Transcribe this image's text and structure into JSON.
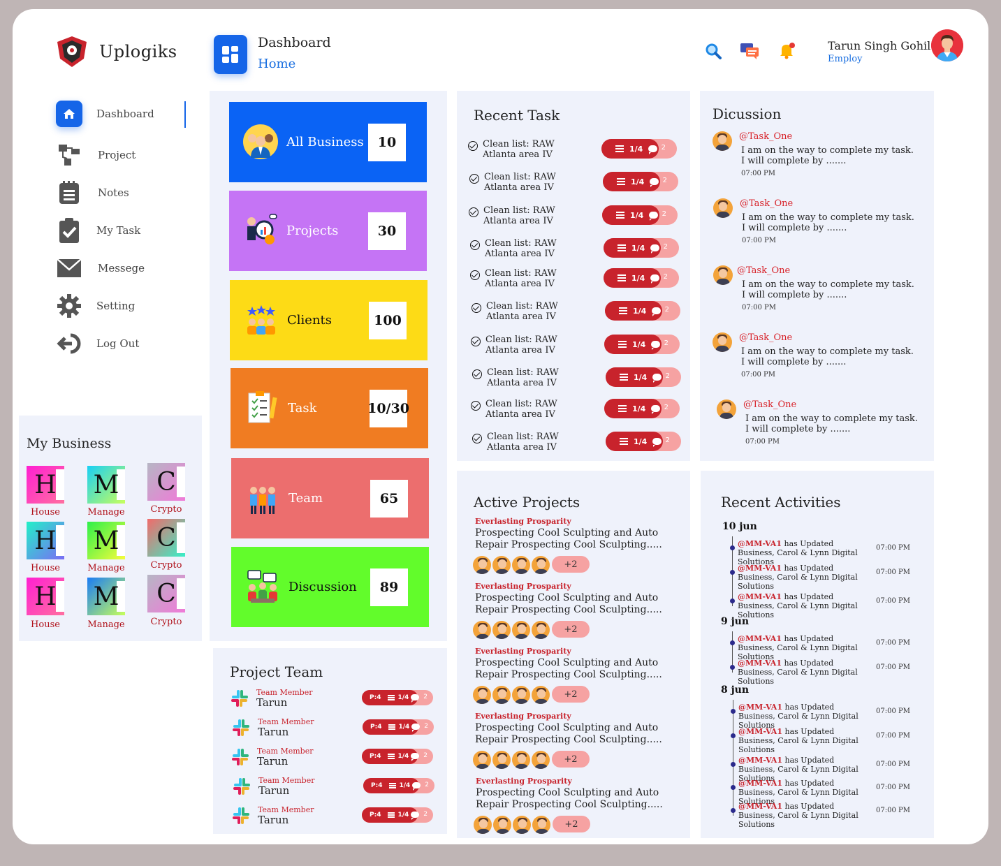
{
  "brand": {
    "name": "Uplogiks"
  },
  "header": {
    "title": "Dashboard",
    "breadcrumb": "Home"
  },
  "user": {
    "name": "Tarun Singh Gohil",
    "role": "Employ"
  },
  "nav": [
    {
      "label": "Dashboard",
      "icon": "home-icon"
    },
    {
      "label": "Project",
      "icon": "project-icon"
    },
    {
      "label": "Notes",
      "icon": "notes-icon"
    },
    {
      "label": "My Task",
      "icon": "clipboard-check-icon"
    },
    {
      "label": "Messege",
      "icon": "mail-icon"
    },
    {
      "label": "Setting",
      "icon": "gear-icon"
    },
    {
      "label": "Log Out",
      "icon": "logout-icon"
    }
  ],
  "business": {
    "title": "My Business",
    "items": [
      {
        "letter": "H",
        "label": "House"
      },
      {
        "letter": "M",
        "label": "Manage"
      },
      {
        "letter": "C",
        "label": "Crypto"
      },
      {
        "letter": "H",
        "label": "House"
      },
      {
        "letter": "M",
        "label": "Manage"
      },
      {
        "letter": "C",
        "label": "Crypto"
      },
      {
        "letter": "H",
        "label": "House"
      },
      {
        "letter": "M",
        "label": "Manage"
      },
      {
        "letter": "C",
        "label": "Crypto"
      }
    ]
  },
  "stats": [
    {
      "label": "All Business",
      "value": "10",
      "color": "#0a63f5"
    },
    {
      "label": "Projects",
      "value": "30",
      "color": "#c574f5"
    },
    {
      "label": "Clients",
      "value": "100",
      "color": "#fddb16"
    },
    {
      "label": "Task",
      "value": "10/30",
      "color": "#f07c22"
    },
    {
      "label": "Team",
      "value": "65",
      "color": "#ec6e6e"
    },
    {
      "label": "Discussion",
      "value": "89",
      "color": "#62fc2b"
    }
  ],
  "recent_task": {
    "title": "Recent Task",
    "items": [
      {
        "text": "Clean list: RAW Atlanta area IV",
        "progress": "1/4",
        "comments": "2"
      },
      {
        "text": "Clean list: RAW Atlanta area IV",
        "progress": "1/4",
        "comments": "2"
      },
      {
        "text": "Clean list: RAW Atlanta area IV",
        "progress": "1/4",
        "comments": "2"
      },
      {
        "text": "Clean list: RAW Atlanta area IV",
        "progress": "1/4",
        "comments": "2"
      },
      {
        "text": "Clean list: RAW Atlanta area IV",
        "progress": "1/4",
        "comments": "2"
      },
      {
        "text": "Clean list: RAW Atlanta area IV",
        "progress": "1/4",
        "comments": "2"
      },
      {
        "text": "Clean list: RAW Atlanta area IV",
        "progress": "1/4",
        "comments": "2"
      },
      {
        "text": "Clean list: RAW Atlanta area IV",
        "progress": "1/4",
        "comments": "2"
      },
      {
        "text": "Clean list: RAW Atlanta area IV",
        "progress": "1/4",
        "comments": "2"
      },
      {
        "text": "Clean list: RAW Atlanta area IV",
        "progress": "1/4",
        "comments": "2"
      }
    ]
  },
  "discussion": {
    "title": "Dicussion",
    "items": [
      {
        "user": "@Task_One",
        "message": "I am on the way to complete my task. I will complete by .......",
        "time": "07:00 PM"
      },
      {
        "user": "@Task_One",
        "message": "I am on the way to complete my task. I will complete by .......",
        "time": "07:00 PM"
      },
      {
        "user": "@Task_One",
        "message": "I am on the way to complete my task. I will complete by .......",
        "time": "07:00 PM"
      },
      {
        "user": "@Task_One",
        "message": "I am on the way to complete my task. I will complete by .......",
        "time": "07:00 PM"
      },
      {
        "user": "@Task_One",
        "message": "I am on the way to complete my task. I will complete by .......",
        "time": "07:00 PM"
      }
    ]
  },
  "active_projects": {
    "title": "Active Projects",
    "items": [
      {
        "tag": "Everlasting Prosparity",
        "desc": "Prospecting Cool Sculpting and Auto Repair Prospecting Cool Sculpting.....",
        "more": "+2"
      },
      {
        "tag": "Everlasting Prosparity",
        "desc": "Prospecting Cool Sculpting and Auto Repair Prospecting Cool Sculpting.....",
        "more": "+2"
      },
      {
        "tag": "Everlasting Prosparity",
        "desc": "Prospecting Cool Sculpting and Auto Repair Prospecting Cool Sculpting.....",
        "more": "+2"
      },
      {
        "tag": "Everlasting Prosparity",
        "desc": "Prospecting Cool Sculpting and Auto Repair Prospecting Cool Sculpting.....",
        "more": "+2"
      },
      {
        "tag": "Everlasting Prosparity",
        "desc": "Prospecting Cool Sculpting and Auto Repair Prospecting Cool Sculpting.....",
        "more": "+2"
      }
    ]
  },
  "project_team": {
    "title": "Project Team",
    "items": [
      {
        "role": "Team Member",
        "name": "Tarun",
        "p": "P:4",
        "progress": "1/4",
        "comments": "2"
      },
      {
        "role": "Team Member",
        "name": "Tarun",
        "p": "P:4",
        "progress": "1/4",
        "comments": "2"
      },
      {
        "role": "Team Member",
        "name": "Tarun",
        "p": "P:4",
        "progress": "1/4",
        "comments": "2"
      },
      {
        "role": "Team Member",
        "name": "Tarun",
        "p": "P:4",
        "progress": "1/4",
        "comments": "2"
      },
      {
        "role": "Team Member",
        "name": "Tarun",
        "p": "P:4",
        "progress": "1/4",
        "comments": "2"
      }
    ]
  },
  "recent_activities": {
    "title": "Recent Activities",
    "groups": [
      {
        "date": "10 jun",
        "items": [
          {
            "user": "@MM-VA1",
            "text": " has Updated Business, Carol & Lynn Digital Solutions",
            "time": "07:00 PM"
          },
          {
            "user": "@MM-VA1",
            "text": " has Updated Business, Carol & Lynn Digital Solutions",
            "time": "07:00 PM"
          },
          {
            "user": "@MM-VA1",
            "text": " has Updated Business, Carol & Lynn Digital Solutions",
            "time": "07:00 PM"
          }
        ]
      },
      {
        "date": "9 jun",
        "items": [
          {
            "user": "@MM-VA1",
            "text": " has Updated Business, Carol & Lynn Digital Solutions",
            "time": "07:00 PM"
          },
          {
            "user": "@MM-VA1",
            "text": " has Updated Business, Carol & Lynn Digital Solutions",
            "time": "07:00 PM"
          }
        ]
      },
      {
        "date": "8 jun",
        "items": [
          {
            "user": "@MM-VA1",
            "text": " has Updated Business, Carol & Lynn Digital Solutions",
            "time": "07:00 PM"
          },
          {
            "user": "@MM-VA1",
            "text": " has Updated Business, Carol & Lynn Digital Solutions",
            "time": "07:00 PM"
          },
          {
            "user": "@MM-VA1",
            "text": " has Updated Business, Carol & Lynn Digital Solutions",
            "time": "07:00 PM"
          },
          {
            "user": "@MM-VA1",
            "text": " has Updated Business, Carol & Lynn Digital Solutions",
            "time": "07:00 PM"
          },
          {
            "user": "@MM-VA1",
            "text": " has Updated Business, Carol & Lynn Digital Solutions",
            "time": "07:00 PM"
          }
        ]
      }
    ]
  },
  "colors": {
    "accent": "#1565e8",
    "danger": "#c8232c",
    "danger_light": "#f6a2a2",
    "panel": "#eff2fb"
  }
}
